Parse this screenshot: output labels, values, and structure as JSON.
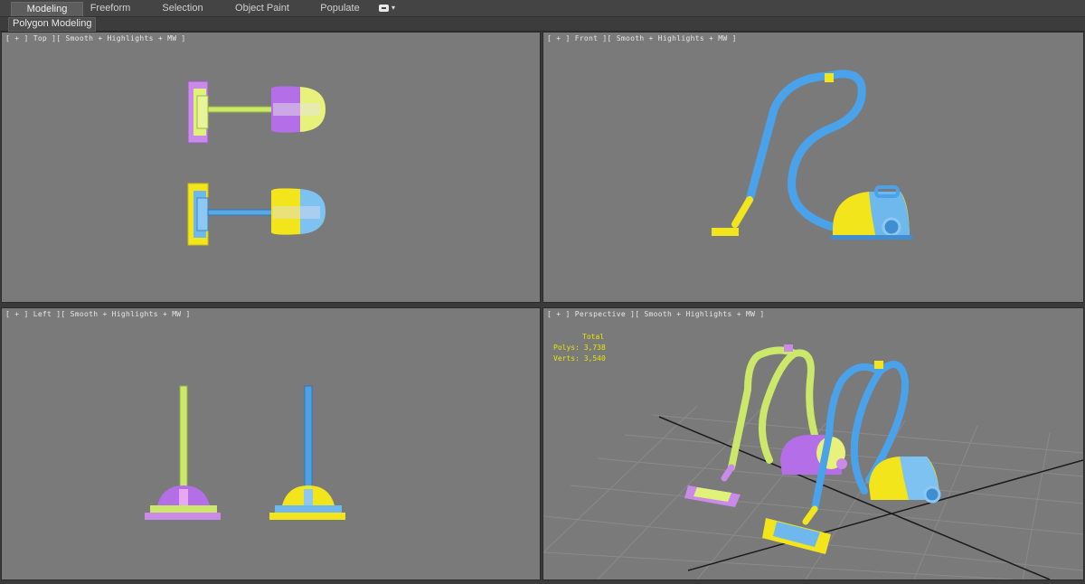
{
  "ribbon": {
    "tabs": [
      {
        "label": "Modeling",
        "active": true
      },
      {
        "label": "Freeform",
        "active": false
      },
      {
        "label": "Selection",
        "active": false
      },
      {
        "label": "Object Paint",
        "active": false
      },
      {
        "label": "Populate",
        "active": false
      }
    ],
    "toggle_icon": "panel-toggle-icon"
  },
  "subpanel": {
    "label": "Polygon Modeling"
  },
  "viewports": {
    "top": {
      "label": "[ + ] Top ][ Smooth + Highlights + MW ]"
    },
    "front": {
      "label": "[ + ] Front ][ Smooth + Highlights + MW ]"
    },
    "left": {
      "label": "[ + ] Left ][ Smooth + Highlights + MW ]"
    },
    "perspective": {
      "label": "[ + ] Perspective ][ Smooth + Highlights + MW ]"
    }
  },
  "stats": {
    "header": "Total",
    "polys_label": "Polys:",
    "polys_value": "3,738",
    "verts_label": "Verts:",
    "verts_value": "3,540"
  },
  "colors": {
    "viewport_bg": "#7a7a7a",
    "blue": "#4aa3ea",
    "yellow": "#f2e51c",
    "purple": "#b36ee8",
    "lime": "#d9f070",
    "stats_text": "#e6e600"
  }
}
